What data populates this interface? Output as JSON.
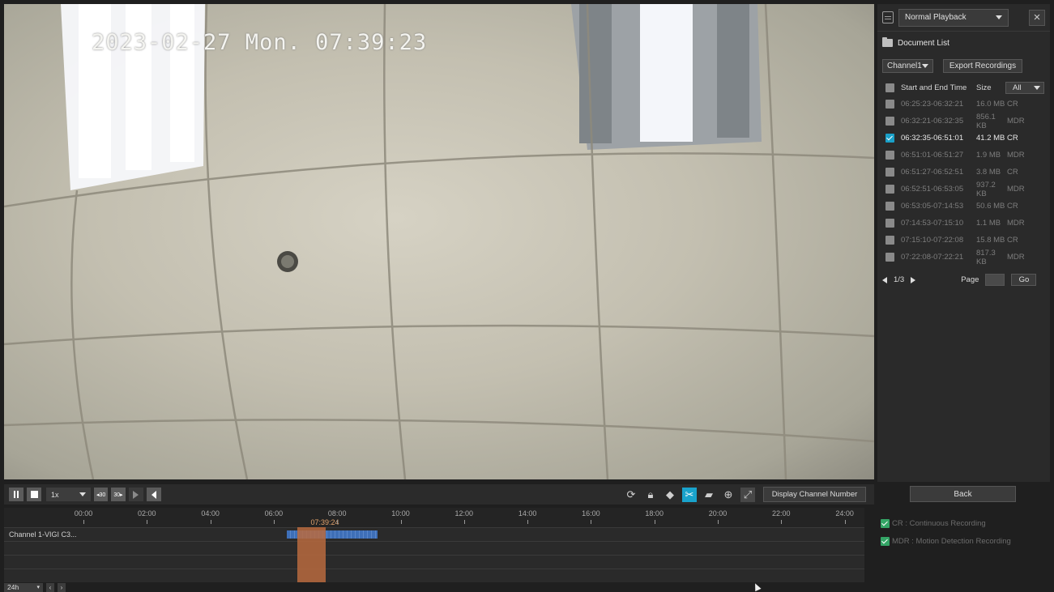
{
  "video": {
    "osd_time": "2023-02-27 Mon. 07:39:23"
  },
  "side_panel": {
    "mode": "Normal Playback",
    "doc_list_title": "Document List",
    "channel": "Channel1",
    "export_label": "Export Recordings",
    "header": {
      "time": "Start and End Time",
      "size": "Size",
      "type_filter": "All"
    },
    "rows": [
      {
        "time": "06:25:23-06:32:21",
        "size": "16.0 MB",
        "type": "CR",
        "checked": false
      },
      {
        "time": "06:32:21-06:32:35",
        "size": "856.1 KB",
        "type": "MDR",
        "checked": false
      },
      {
        "time": "06:32:35-06:51:01",
        "size": "41.2 MB",
        "type": "CR",
        "checked": true
      },
      {
        "time": "06:51:01-06:51:27",
        "size": "1.9 MB",
        "type": "MDR",
        "checked": false
      },
      {
        "time": "06:51:27-06:52:51",
        "size": "3.8 MB",
        "type": "CR",
        "checked": false
      },
      {
        "time": "06:52:51-06:53:05",
        "size": "937.2 KB",
        "type": "MDR",
        "checked": false
      },
      {
        "time": "06:53:05-07:14:53",
        "size": "50.6 MB",
        "type": "CR",
        "checked": false
      },
      {
        "time": "07:14:53-07:15:10",
        "size": "1.1 MB",
        "type": "MDR",
        "checked": false
      },
      {
        "time": "07:15:10-07:22:08",
        "size": "15.8 MB",
        "type": "CR",
        "checked": false
      },
      {
        "time": "07:22:08-07:22:21",
        "size": "817.3 KB",
        "type": "MDR",
        "checked": false
      }
    ],
    "pager": {
      "page": "1/3",
      "page_label": "Page",
      "go_label": "Go"
    },
    "back_label": "Back"
  },
  "toolbar": {
    "speed": "1x",
    "skip_back": "◂30",
    "skip_fwd": "30▸",
    "display_channel_label": "Display Channel Number"
  },
  "timeline": {
    "ticks": [
      "00:00",
      "02:00",
      "04:00",
      "06:00",
      "08:00",
      "10:00",
      "12:00",
      "14:00",
      "16:00",
      "18:00",
      "20:00",
      "22:00",
      "24:00"
    ],
    "current_time": "07:39:24",
    "channel_label": "Channel 1-VIGI C3...",
    "zoom": "24h"
  },
  "legend": {
    "cr": "CR : Continuous Recording",
    "mdr": "MDR : Motion Detection Recording"
  },
  "colors": {
    "accent": "#19a3cc",
    "recording_bar": "#3e6fb8",
    "cursor": "#b86a3e",
    "legend_check": "#34a566"
  }
}
